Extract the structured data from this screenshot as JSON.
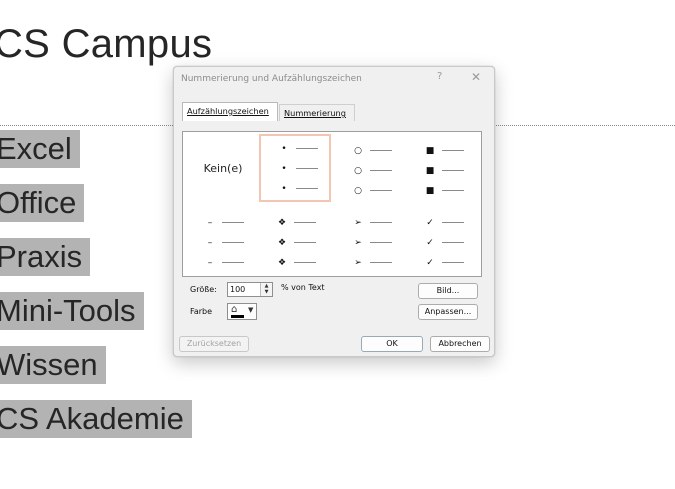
{
  "slide": {
    "title": "CS Campus",
    "bullets": [
      "Excel",
      "Office",
      "Praxis",
      "Mini-Tools",
      "Wissen",
      "CS Akademie"
    ]
  },
  "dialog": {
    "title": "Nummerierung und Aufzählungszeichen",
    "help_glyph": "?",
    "close_glyph": "✕",
    "tabs": [
      {
        "label": "Aufzählungszeichen",
        "active": true
      },
      {
        "label": "Nummerierung",
        "active": false
      }
    ],
    "gallery": {
      "none_label": "Kein(e)",
      "options": [
        {
          "name": "none",
          "selected": true
        },
        {
          "name": "filled-round",
          "symbol": "•"
        },
        {
          "name": "hollow-round",
          "symbol": "○"
        },
        {
          "name": "filled-square",
          "symbol": "■"
        },
        {
          "name": "dash",
          "symbol": "–"
        },
        {
          "name": "star-diamond",
          "symbol": "❖"
        },
        {
          "name": "arrow",
          "symbol": "➢"
        },
        {
          "name": "checkmark",
          "symbol": "✓"
        }
      ]
    },
    "size_label": "Größe:",
    "size_value": "100",
    "size_unit": "% von Text",
    "color_label": "Farbe",
    "color_value": "#000000",
    "buttons": {
      "picture": "Bild...",
      "customize": "Anpassen...",
      "reset": "Zurücksetzen",
      "ok": "OK",
      "cancel": "Abbrechen"
    }
  },
  "colors": {
    "selection_border": "#f3c6b4",
    "bullet_highlight": "#b3b3b3"
  }
}
